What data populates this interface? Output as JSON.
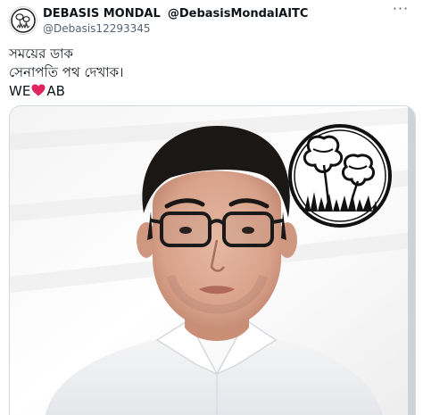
{
  "tweet": {
    "display_name": "DEBASIS MONDAL",
    "name_handle": "@DebasisMondalAITC",
    "handle": "@Debasis12293345",
    "more_glyph": "···",
    "text_line1": "সময়ের ডাক",
    "text_line2": "সেনাপতি পথ দেখাক।",
    "text_we": "WE",
    "text_ab": "AB"
  },
  "colors": {
    "text": "#0f1419",
    "secondary": "#536471",
    "heart": "#e0245e",
    "border": "#cfd9de"
  },
  "icons": {
    "heart": "red-heart-icon",
    "more": "more-options-icon",
    "logo": "twin-flowers-grass-logo"
  }
}
